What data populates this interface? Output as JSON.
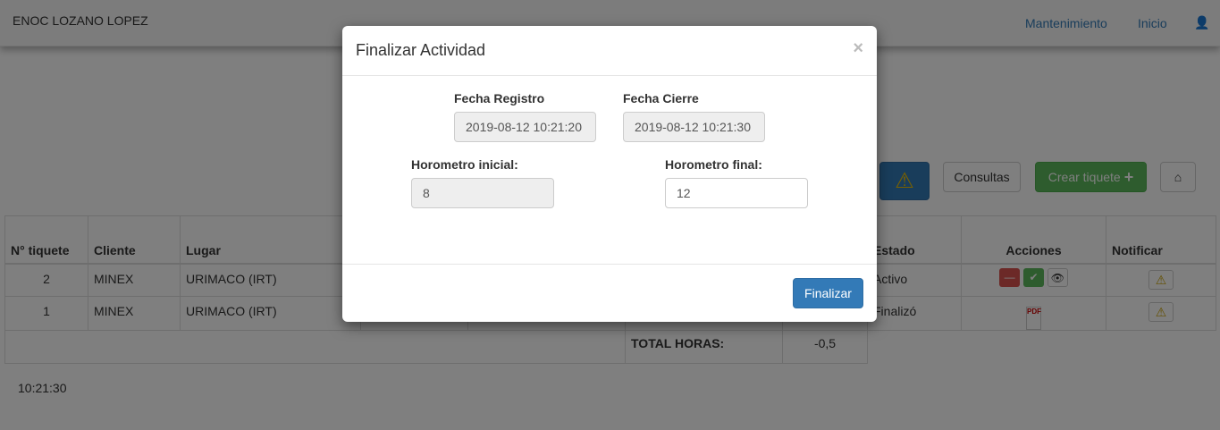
{
  "navbar": {
    "brand": "ENOC LOZANO LOPEZ",
    "links": [
      "Mantenimiento",
      "Inicio"
    ]
  },
  "toolbar": {
    "consultas": "Consultas",
    "crear": "Crear tiquete"
  },
  "table": {
    "headers": [
      "N° tiquete",
      "Cliente",
      "Lugar",
      "",
      "",
      "",
      "",
      "Estado",
      "Acciones",
      "Notificar"
    ],
    "rows": [
      {
        "num": "2",
        "cliente": "MINEX",
        "lugar": "URIMACO (IRT)",
        "estado": "Activo"
      },
      {
        "num": "1",
        "cliente": "MINEX",
        "lugar": "URIMACO (IRT)",
        "estado": "Finalizó"
      }
    ],
    "total_label": "TOTAL HORAS:",
    "total_value": "-0,5"
  },
  "clock": "10:21:30",
  "modal": {
    "title": "Finalizar Actividad",
    "close": "×",
    "fecha_registro_label": "Fecha Registro",
    "fecha_registro": "2019-08-12 10:21:20",
    "fecha_cierre_label": "Fecha Cierre",
    "fecha_cierre": "2019-08-12 10:21:30",
    "horometro_inicial_label": "Horometro inicial:",
    "horometro_inicial": "8",
    "horometro_final_label": "Horometro final:",
    "horometro_final": "12",
    "submit": "Finalizar"
  }
}
